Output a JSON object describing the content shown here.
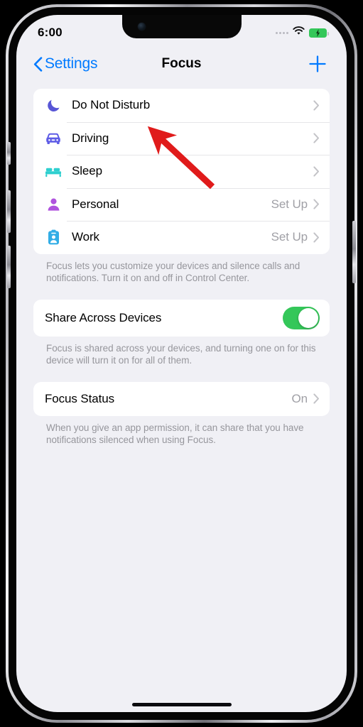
{
  "status_bar": {
    "time": "6:00",
    "cellular_icon": "cellular-dots-icon",
    "wifi_icon": "wifi-icon",
    "battery_icon": "battery-charging-icon",
    "battery_color": "#34c759"
  },
  "nav_bar": {
    "back_label": "Settings",
    "back_icon": "chevron-left-icon",
    "title": "Focus",
    "add_icon": "plus-icon",
    "tint_color": "#007aff"
  },
  "focus_list": {
    "items": [
      {
        "label": "Do Not Disturb",
        "value": "",
        "icon": "crescent-moon-icon",
        "icon_color": "#5856d6"
      },
      {
        "label": "Driving",
        "value": "",
        "icon": "car-icon",
        "icon_color": "#5e5ce6"
      },
      {
        "label": "Sleep",
        "value": "",
        "icon": "bed-icon",
        "icon_color": "#2ecfcf"
      },
      {
        "label": "Personal",
        "value": "Set Up",
        "icon": "person-icon",
        "icon_color": "#af52de"
      },
      {
        "label": "Work",
        "value": "Set Up",
        "icon": "id-badge-icon",
        "icon_color": "#32ade6"
      }
    ],
    "footnote": "Focus lets you customize your devices and silence calls and notifications. Turn it on and off in Control Center."
  },
  "share_across_devices": {
    "label": "Share Across Devices",
    "toggle_state": "on",
    "toggle_color": "#34c759",
    "footnote": "Focus is shared across your devices, and turning one on for this device will turn it on for all of them."
  },
  "focus_status": {
    "label": "Focus Status",
    "value": "On",
    "footnote": "When you give an app permission, it can share that you have notifications silenced when using Focus."
  },
  "annotation": {
    "arrow_color": "#e01b1b",
    "points_to": "Do Not Disturb"
  },
  "device": {
    "home_indicator": "home-indicator",
    "buttons": [
      "mute-switch",
      "volume-up-button",
      "volume-down-button",
      "power-button"
    ]
  }
}
